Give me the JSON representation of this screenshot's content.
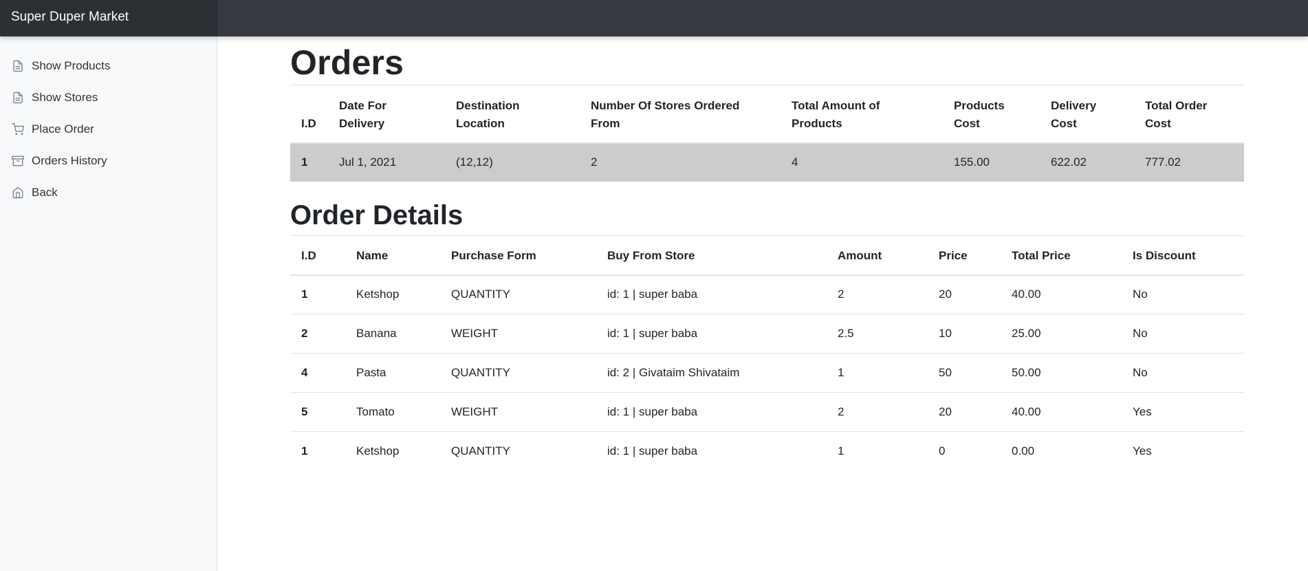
{
  "navbar": {
    "brand": "Super Duper Market"
  },
  "sidebar": {
    "items": [
      {
        "label": "Show Products",
        "icon": "file-text-icon"
      },
      {
        "label": "Show Stores",
        "icon": "file-text-icon"
      },
      {
        "label": "Place Order",
        "icon": "shopping-cart-icon"
      },
      {
        "label": "Orders History",
        "icon": "archive-icon"
      },
      {
        "label": "Back",
        "icon": "home-icon"
      }
    ]
  },
  "orders": {
    "title": "Orders",
    "headers": {
      "id": "I.D",
      "date": "Date For Delivery",
      "destination": "Destination Location",
      "stores": "Number Of Stores Ordered From",
      "amount": "Total Amount of Products",
      "products_cost": "Products Cost",
      "delivery_cost": "Delivery Cost",
      "total_cost": "Total Order Cost"
    },
    "rows": [
      {
        "id": "1",
        "date": "Jul 1, 2021",
        "destination": "(12,12)",
        "stores": "2",
        "amount": "4",
        "products_cost": "155.00",
        "delivery_cost": "622.02",
        "total_cost": "777.02"
      }
    ],
    "selected_row_color": "#cccccc"
  },
  "details": {
    "title": "Order Details",
    "headers": {
      "id": "I.D",
      "name": "Name",
      "form": "Purchase Form",
      "store": "Buy From Store",
      "amount": "Amount",
      "price": "Price",
      "total": "Total Price",
      "discount": "Is Discount"
    },
    "rows": [
      {
        "id": "1",
        "name": "Ketshop",
        "form": "QUANTITY",
        "store": "id: 1 | super baba",
        "amount": "2",
        "price": "20",
        "total": "40.00",
        "discount": "No"
      },
      {
        "id": "2",
        "name": "Banana",
        "form": "WEIGHT",
        "store": "id: 1 | super baba",
        "amount": "2.5",
        "price": "10",
        "total": "25.00",
        "discount": "No"
      },
      {
        "id": "4",
        "name": "Pasta",
        "form": "QUANTITY",
        "store": "id: 2 | Givataim Shivataim",
        "amount": "1",
        "price": "50",
        "total": "50.00",
        "discount": "No"
      },
      {
        "id": "5",
        "name": "Tomato",
        "form": "WEIGHT",
        "store": "id: 1 | super baba",
        "amount": "2",
        "price": "20",
        "total": "40.00",
        "discount": "Yes"
      },
      {
        "id": "1",
        "name": "Ketshop",
        "form": "QUANTITY",
        "store": "id: 1 | super baba",
        "amount": "1",
        "price": "0",
        "total": "0.00",
        "discount": "Yes"
      }
    ]
  },
  "colors": {
    "navbar_bg": "#343a40",
    "sidebar_bg": "#f8f9fa",
    "text": "#212529"
  }
}
